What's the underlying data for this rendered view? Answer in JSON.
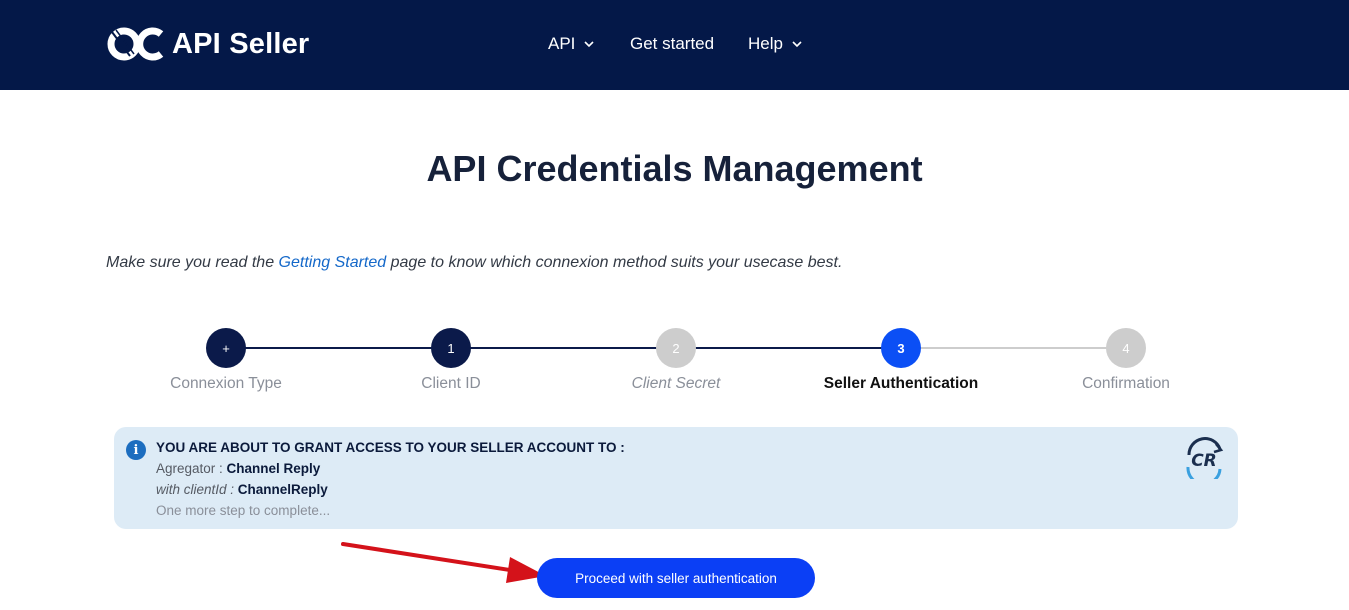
{
  "header": {
    "logo_text": "API Seller",
    "nav": [
      {
        "label": "API",
        "has_dropdown": true
      },
      {
        "label": "Get started",
        "has_dropdown": false
      },
      {
        "label": "Help",
        "has_dropdown": true
      }
    ]
  },
  "page": {
    "title": "API Credentials Management",
    "intro_prefix": "Make sure you read the ",
    "intro_link": "Getting Started",
    "intro_suffix": " page to know which connexion method suits your usecase best."
  },
  "stepper": {
    "steps": [
      {
        "marker": "+",
        "label": "Connexion Type",
        "state": "done"
      },
      {
        "marker": "1",
        "label": "Client ID",
        "state": "done"
      },
      {
        "marker": "2",
        "label": "Client Secret",
        "state": "todo"
      },
      {
        "marker": "3",
        "label": "Seller Authentication",
        "state": "active"
      },
      {
        "marker": "4",
        "label": "Confirmation",
        "state": "todo"
      }
    ]
  },
  "info": {
    "icon": "i",
    "heading": "YOU ARE ABOUT TO GRANT ACCESS TO YOUR SELLER ACCOUNT TO :",
    "aggregator_label": "Agregator : ",
    "aggregator_value": "Channel Reply",
    "client_label": "with clientId : ",
    "client_value": "ChannelReply",
    "note": "One more step to complete...",
    "partner_logo_text": "CR"
  },
  "actions": {
    "proceed_label": "Proceed with seller authentication"
  },
  "colors": {
    "header_bg": "#041848",
    "step_done": "#0b1a4a",
    "step_active": "#0b4ff5",
    "step_todo": "#cdcdcd",
    "info_bg": "#ddebf6",
    "button_bg": "#0b3ff5",
    "annotation_arrow": "#d4121a"
  }
}
